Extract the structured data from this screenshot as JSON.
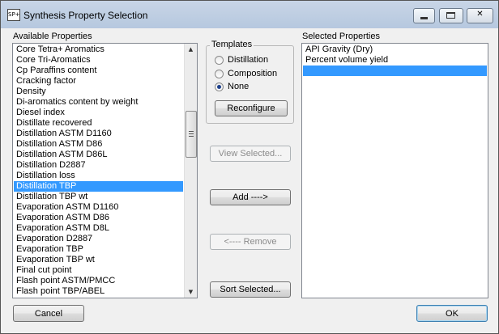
{
  "window": {
    "title": "Synthesis Property Selection",
    "icon": "app-icon"
  },
  "available": {
    "label": "Available Properties",
    "items": [
      "Core Tetra+ Aromatics",
      "Core Tri-Aromatics",
      "Cp Paraffins content",
      "Cracking factor",
      "Density",
      "Di-aromatics content by weight",
      "Diesel index",
      "Distillate recovered",
      "Distillation ASTM D1160",
      "Distillation ASTM D86",
      "Distillation ASTM D86L",
      "Distillation D2887",
      "Distillation loss",
      "Distillation TBP",
      "Distillation TBP wt",
      "Evaporation ASTM D1160",
      "Evaporation ASTM D86",
      "Evaporation ASTM D8L",
      "Evaporation D2887",
      "Evaporation TBP",
      "Evaporation TBP wt",
      "Final cut point",
      "Flash point ASTM/PMCC",
      "Flash point TBP/ABEL"
    ],
    "selected_item": "Distillation TBP"
  },
  "templates": {
    "title": "Templates",
    "options": [
      "Distillation",
      "Composition",
      "None"
    ],
    "selected_option": "None",
    "reconfigure_label": "Reconfigure"
  },
  "actions": {
    "view_selected": "View Selected...",
    "add": "Add ---->",
    "remove": "<---- Remove",
    "sort_selected": "Sort Selected..."
  },
  "selected": {
    "label": "Selected Properties",
    "items": [
      "API Gravity (Dry)",
      "Percent volume yield",
      ""
    ]
  },
  "footer": {
    "cancel_label": "Cancel",
    "ok_label": "OK"
  },
  "colors": {
    "selection": "#3399ff",
    "titlebar": "#bfd0e4"
  }
}
